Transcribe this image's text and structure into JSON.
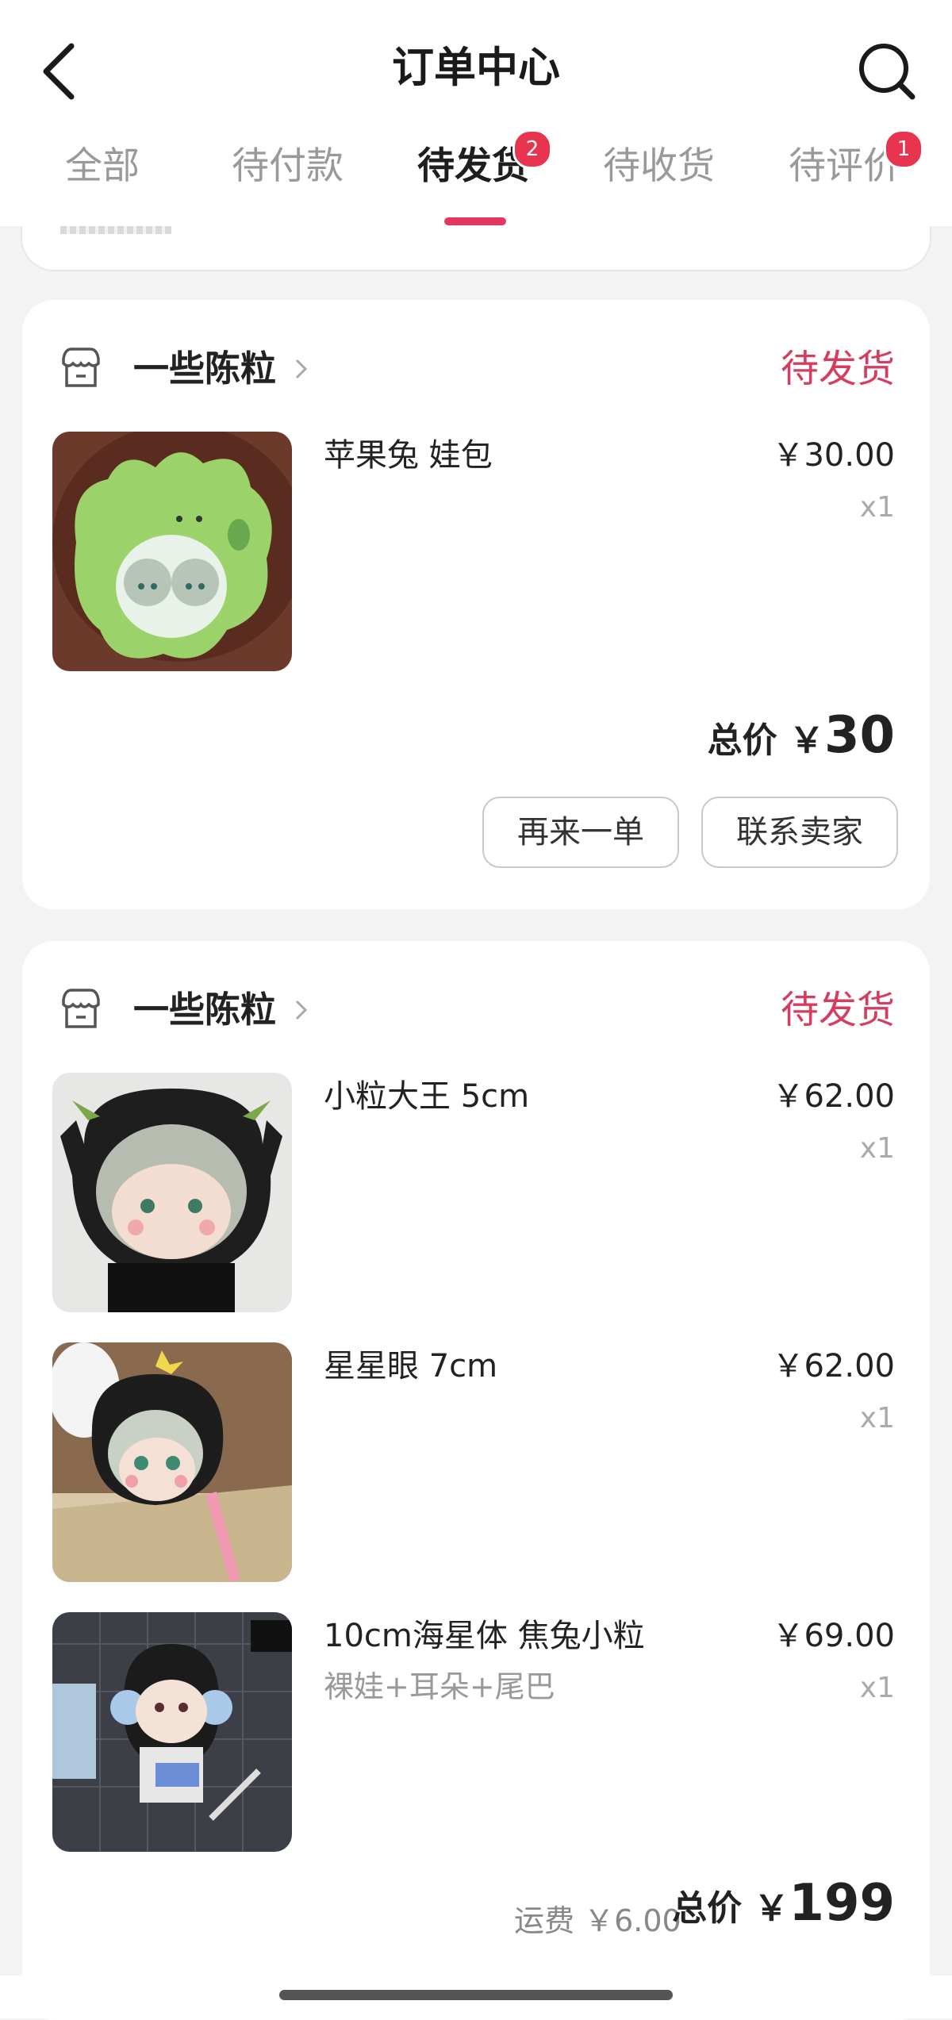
{
  "header": {
    "title": "订单中心",
    "back_icon": "chevron-left-icon",
    "search_icon": "search-icon"
  },
  "tabs": [
    {
      "label": "全部",
      "badge": ""
    },
    {
      "label": "待付款",
      "badge": ""
    },
    {
      "label": "待发货",
      "badge": "2",
      "active": true
    },
    {
      "label": "待收货",
      "badge": ""
    },
    {
      "label": "待评价",
      "badge": "1"
    }
  ],
  "orders": [
    {
      "shop": "一些陈粒",
      "status": "待发货",
      "items": [
        {
          "name": "苹果兔 娃包",
          "sub": "",
          "price": "￥30.00",
          "qty": "x1"
        }
      ],
      "total_label": "总价 ￥",
      "total": "30",
      "buttons": [
        "再来一单",
        "联系卖家"
      ]
    },
    {
      "shop": "一些陈粒",
      "status": "待发货",
      "items": [
        {
          "name": "小粒大王 5cm",
          "sub": "",
          "price": "￥62.00",
          "qty": "x1"
        },
        {
          "name": "星星眼 7cm",
          "sub": "",
          "price": "￥62.00",
          "qty": "x1"
        },
        {
          "name": "10cm海星体 焦兔小粒",
          "sub": "裸娃+耳朵+尾巴",
          "price": "￥69.00",
          "qty": "x1"
        }
      ],
      "shipping": "运费 ￥6.00",
      "total_label": "总价 ￥",
      "total": "199"
    }
  ],
  "colors": {
    "accent": "#e3375f",
    "status": "#d63c5e",
    "badge": "#e8344f",
    "background": "#f3f3f3"
  }
}
